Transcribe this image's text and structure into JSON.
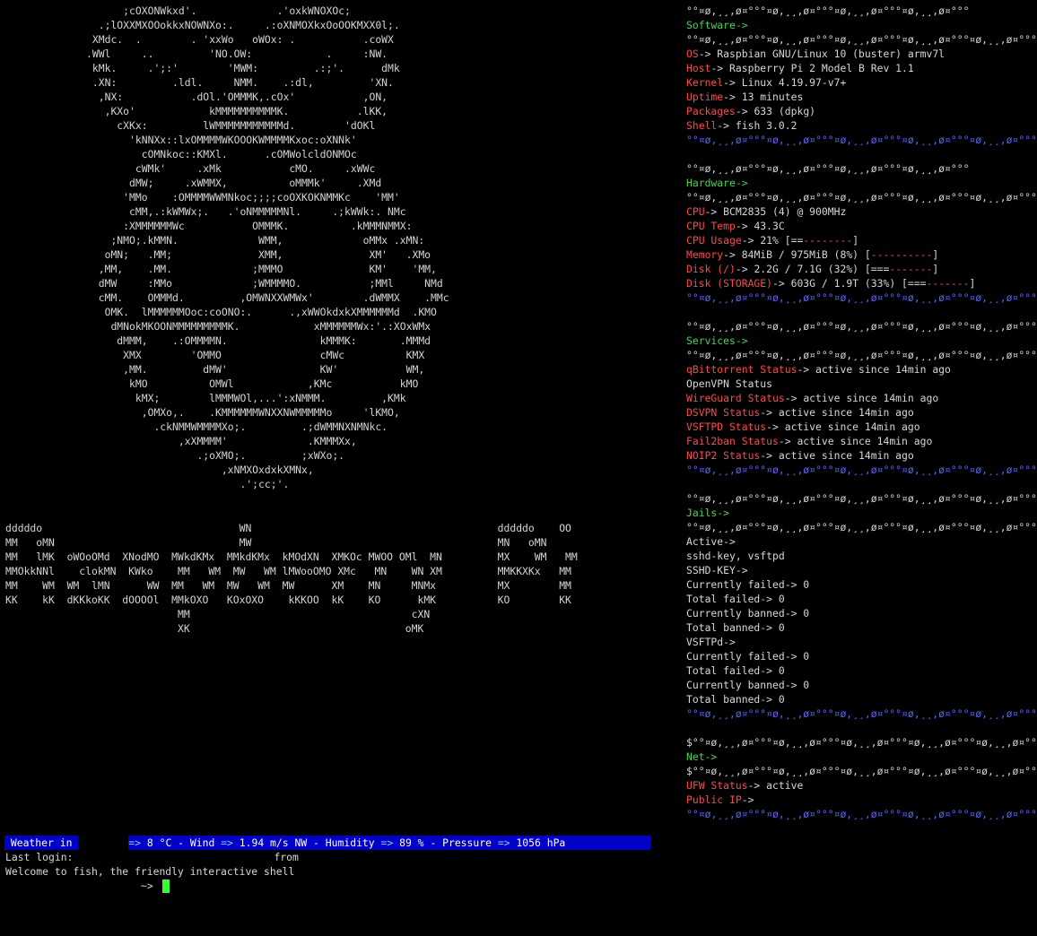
{
  "ascii_art": "                    ;cOXONWkxd'.             .'oxkWNOXOc;\n                .;lOXXMXOOokkxNOWNXo:.     .:oXNMOXkxOoOOKMXX0l;.\n               XMdc.  .        . 'xxWo   oWOx: .           .coWX\n              .WWl     ..         'NO.OW:            .     :NW.\n               kMk.     .';:'        'MWM:         .:;'.      dMk\n               .XN:         .ldl.     NMM.    .:dl,         'XN.\n                ,NX:           .dOl.'OMMMK,.cOx'           ,ON,\n                 ,KXo'            kMMMMMMMMMMK.           .lKK,\n                   cXKx:         lWMMMMMMMMMMMd.        'dOKl\n                     'kNNXx::lxOMMMMWKOOOKWMMMMKxoc:oXNNk'\n                       cOMNkoc::KMXl.      .cOMWolcldONMOc\n                      cWMk'     .xMk           cMO.     .xWWc\n                     dMW;     .xWMMX,          oMMMk'     .XMd\n                    'MMo    :OMMMMWWMNkoc;;;;coOXKOKNMMKc    'MM'\n                     cMM,.:kWMWx;.   .'oNMMMMMNl.     .;kWWk:. NMc\n                    :XMMMMMMWc           OMMMK.          .kMMMNMMX:\n                  ;NMO;.kMMN.             WMM,             oMMx .xMN:\n                 oMN;   .MM;              XMM,              XM'   .XMo\n                ,MM,    .MM.             ;MMMO              KM'    'MM,\n                dMW     :MMo             ;WMMMMO.           ;MMl     NMd\n                cMM.    OMMMd.         ,OMWNXXWMWx'        .dWMMX    .MMc\n                 OMK.  lMMMMMMOoc:coONO:.      .,xWWOkdxkXMMMMMMd  .KMO\n                  dMNokMKOONMMMMMMMMMK.            xMMMMMMWx:'.:XOxWMx\n                   dMMM,    .:OMMMMN.               kMMMK:       .MMMd\n                    XMX        'OMMO                cMWc          KMX\n                    ,MM.         dMW'               KW'           WM,\n                     kMO          OMWl            ,KMc           kMO\n                      kMX;        lMMMWOl,...':xNMMM.         ,KMk\n                       ,OMXo,.    .KMMMMMMWNXXNWMMMMMo     'lKMO,\n                         .ckNMMWMMMMXo;.         .;dWMMNXNMNkc.\n                             ,xXMMMM'             .KMMMXx,\n                                .;oXMO;.         ;xWXo;.\n                                    ,xNMXOxdxkXMNx,\n                                       .';cc;'.",
  "ascii_banner": "dddddo                                WN                                        dddddo    OO\nMM   oMN                              MW                                        MN   oMN\nMM   lMK  oWOoOMd  XNodMO  MWkdKMx  MMkdKMx  kMOdXN  XMKOc MWOO OMl  MN         MX    WM   MM\nMMOkkNNl    clokMN  KWko    MM   WM  MW   WM lMWooOMO XMc   MN    WN XM         MMKKXKx   MM\nMM    WM  WM  lMN      WW  MM   WM  MW   WM  MW      XM    MN     MNMx          MX        MM\nKK    kK  dKKkoKK  dOOOOl  MMkOXO   KOxOXO    kKKOO  kK    KO      kMK          KO        KK\n                            MM                                    cXN\n                            XK                                   oMK",
  "software": {
    "separator_top": "°°¤ø,¸¸,ø¤°°°¤ø,¸¸,ø¤°°°¤ø,¸¸,ø¤°°°¤ø,¸¸,ø¤°°°",
    "title": "Software->",
    "separator_mid": "°°¤ø,¸¸,ø¤°°°¤ø,¸¸,ø¤°°°¤ø,¸¸,ø¤°°°¤ø,¸¸,ø¤°°°¤ø,¸¸,ø¤°°°",
    "rows": [
      {
        "key": "OS",
        "value": "Raspbian GNU/Linux 10 (buster) armv7l"
      },
      {
        "key": "Host",
        "value": "Raspberry Pi 2 Model B Rev 1.1"
      },
      {
        "key": "Kernel",
        "value": "Linux 4.19.97-v7+"
      },
      {
        "key": "Uptime",
        "value": "13 minutes"
      },
      {
        "key": "Packages",
        "value": "633 (dpkg)"
      },
      {
        "key": "Shell",
        "value": "fish 3.0.2"
      }
    ],
    "separator_bottom": "°°¤ø,¸¸,ø¤°°°¤ø,¸¸,ø¤°°°¤ø,¸¸,ø¤°°°¤ø,¸¸,ø¤°°°¤ø,¸¸,ø¤°°°"
  },
  "hardware": {
    "separator_top": "°°¤ø,¸¸,ø¤°°°¤ø,¸¸,ø¤°°°¤ø,¸¸,ø¤°°°¤ø,¸¸,ø¤°°°",
    "title": "Hardware->",
    "separator_mid": "°°¤ø,¸¸,ø¤°°°¤ø,¸¸,ø¤°°°¤ø,¸¸,ø¤°°°¤ø,¸¸,ø¤°°°¤ø,¸¸,ø¤°°°",
    "cpu": {
      "key": "CPU",
      "value": "BCM2835 (4) @ 900MHz"
    },
    "cpu_temp": {
      "key": "CPU Temp",
      "value": "43.3C"
    },
    "cpu_usage": {
      "key": "CPU Usage",
      "value": "21% ",
      "bar_fill": "[==",
      "bar_empty": "--------",
      "bar_end": "]"
    },
    "memory": {
      "key": "Memory",
      "value": "84MiB / 975MiB (8%) ",
      "bar_fill": "[",
      "bar_empty": "----------",
      "bar_end": "]"
    },
    "disk_root": {
      "key": "Disk (/)",
      "value": "2.2G / 7.1G (32%) ",
      "bar_fill": "[===",
      "bar_empty": "-------",
      "bar_end": "]"
    },
    "disk_storage": {
      "key": "Disk (STORAGE)",
      "value": "603G / 1.9T (33%) ",
      "bar_fill": "[===",
      "bar_empty": "-------",
      "bar_end": "]"
    },
    "separator_bottom": "°°¤ø,¸¸,ø¤°°°¤ø,¸¸,ø¤°°°¤ø,¸¸,ø¤°°°¤ø,¸¸,ø¤°°°¤ø,¸¸,ø¤°°°"
  },
  "services": {
    "separator_top": "°°¤ø,¸¸,ø¤°°°¤ø,¸¸,ø¤°°°¤ø,¸¸,ø¤°°°¤ø,¸¸,ø¤°°°¤ø,¸¸,ø¤°°°",
    "title": "Services->",
    "separator_mid": "°°¤ø,¸¸,ø¤°°°¤ø,¸¸,ø¤°°°¤ø,¸¸,ø¤°°°¤ø,¸¸,ø¤°°°¤ø,¸¸,ø¤°°°",
    "qbittorrent": {
      "key": "qBittorrent Status",
      "value": "active since 14min ago"
    },
    "openvpn": "OpenVPN Status",
    "rows": [
      {
        "key": "WireGuard Status",
        "value": "active since 14min ago"
      },
      {
        "key": "DSVPN Status",
        "value": "active since 14min ago"
      },
      {
        "key": "VSFTPD Status",
        "value": "active since 14min ago"
      },
      {
        "key": "Fail2ban Status",
        "value": "active since 14min ago"
      },
      {
        "key": "NOIP2 Status",
        "value": "active since 14min ago"
      }
    ],
    "separator_bottom": "°°¤ø,¸¸,ø¤°°°¤ø,¸¸,ø¤°°°¤ø,¸¸,ø¤°°°¤ø,¸¸,ø¤°°°¤ø,¸¸,ø¤°°°"
  },
  "jails": {
    "separator_top": "°°¤ø,¸¸,ø¤°°°¤ø,¸¸,ø¤°°°¤ø,¸¸,ø¤°°°¤ø,¸¸,ø¤°°°¤ø,¸¸,ø¤°°°",
    "title": "Jails->",
    "separator_mid": "°°¤ø,¸¸,ø¤°°°¤ø,¸¸,ø¤°°°¤ø,¸¸,ø¤°°°¤ø,¸¸,ø¤°°°¤ø,¸¸,ø¤°°°",
    "lines": [
      "Active->",
      "sshd-key, vsftpd",
      "SSHD-KEY->",
      "Currently failed-> 0",
      "Total failed-> 0",
      "Currently banned-> 0",
      "Total banned-> 0",
      "VSFTPd->",
      "Currently failed-> 0",
      "Total failed-> 0",
      "Currently banned-> 0",
      "Total banned-> 0"
    ],
    "separator_bottom": "°°¤ø,¸¸,ø¤°°°¤ø,¸¸,ø¤°°°¤ø,¸¸,ø¤°°°¤ø,¸¸,ø¤°°°¤ø,¸¸,ø¤°°°"
  },
  "net": {
    "separator_top": "$°°¤ø,¸¸,ø¤°°°¤ø,¸¸,ø¤°°°¤ø,¸¸,ø¤°°°¤ø,¸¸,ø¤°°°¤ø,¸¸,ø¤°°°",
    "title": "Net->",
    "separator_mid": "$°°¤ø,¸¸,ø¤°°°¤ø,¸¸,ø¤°°°¤ø,¸¸,ø¤°°°¤ø,¸¸,ø¤°°°¤ø,¸¸,ø¤°°°",
    "ufw": {
      "key": "UFW Status",
      "value": "active"
    },
    "public_ip": {
      "key": "Public IP",
      "value": ""
    },
    "separator_bottom": "°°¤ø,¸¸,ø¤°°°¤ø,¸¸,ø¤°°°¤ø,¸¸,ø¤°°°¤ø,¸¸,ø¤°°°¤ø,¸¸,ø¤°°°"
  },
  "arrow": "->",
  "weather": {
    "label": " Weather in ",
    "temp_arrow": "=>",
    "temp": " 8 °C ",
    "dash1": "- ",
    "wind_label": "Wind ",
    "wind_arrow": "=>",
    "wind": " 1.94 m/s NW ",
    "dash2": "- ",
    "hum_label": "Humidity ",
    "hum_arrow": "=>",
    "humidity": " 89 % ",
    "dash3": "- ",
    "press_label": "Pressure ",
    "press_arrow": "=>",
    "pressure": " 1056 hPa"
  },
  "last_login": {
    "label": "Last login:",
    "from": "from"
  },
  "welcome": "Welcome to fish, the friendly interactive shell",
  "prompt": "~>",
  "colors": {
    "background": "#000000",
    "text": "#d6d6d6",
    "key": "#ff4747",
    "section": "#43d64b",
    "separator_blue": "#5b63ff",
    "weather_bg": "#0000c8",
    "cursor": "#33ff33"
  }
}
